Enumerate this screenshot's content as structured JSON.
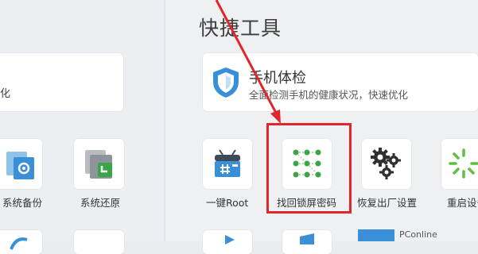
{
  "left_panel": {
    "top_card_text": "化",
    "tiles": [
      {
        "label": "系统备份",
        "icon": "backup-icon"
      },
      {
        "label": "系统还原",
        "icon": "restore-icon"
      }
    ]
  },
  "quick_tools": {
    "title": "快捷工具",
    "phone_check": {
      "title": "手机体检",
      "subtitle": "全面检测手机的健康状况，快速优化",
      "icon": "shield-icon"
    },
    "tiles": [
      {
        "label": "一键Root",
        "icon": "android-root-icon"
      },
      {
        "label": "找回锁屏密码",
        "icon": "pattern-lock-icon"
      },
      {
        "label": "恢复出厂设置",
        "icon": "gears-icon"
      },
      {
        "label": "重启设备",
        "icon": "restart-icon"
      }
    ],
    "bottom_strip_text": "PConline"
  },
  "colors": {
    "accent_blue": "#3a8fd9",
    "highlight_red": "#e0262a",
    "green": "#3aa546"
  }
}
